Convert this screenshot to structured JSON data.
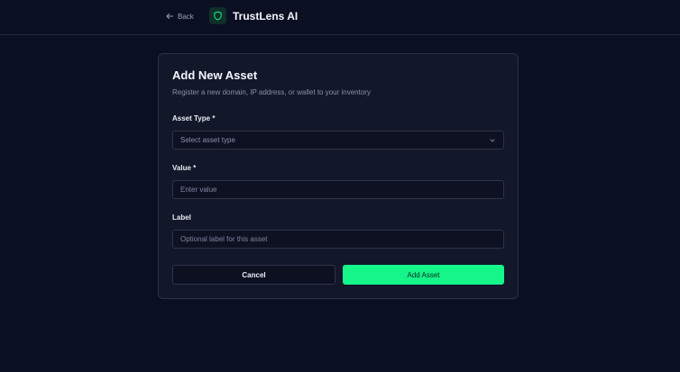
{
  "header": {
    "back_label": "Back",
    "brand_name": "TrustLens AI"
  },
  "form": {
    "title": "Add New Asset",
    "subtitle": "Register a new domain, IP address, or wallet to your inventory",
    "asset_type": {
      "label": "Asset Type *",
      "placeholder": "Select asset type"
    },
    "value": {
      "label": "Value *",
      "placeholder": "Enter value"
    },
    "asset_label": {
      "label": "Label",
      "placeholder": "Optional label for this asset"
    },
    "cancel_label": "Cancel",
    "submit_label": "Add Asset"
  },
  "colors": {
    "background": "#0b0f22",
    "card": "#121729",
    "accent": "#14f58a"
  }
}
